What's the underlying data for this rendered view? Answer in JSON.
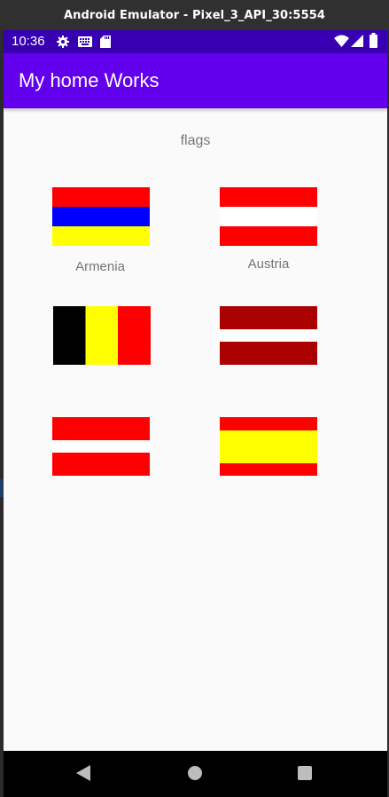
{
  "window": {
    "title": "Android Emulator - Pixel_3_API_30:5554"
  },
  "status_bar": {
    "time": "10:36",
    "icons": [
      "gear-icon",
      "keyboard-icon",
      "sd-card-icon",
      "wifi-icon",
      "signal-icon",
      "battery-icon"
    ]
  },
  "app_bar": {
    "title": "My home Works"
  },
  "main": {
    "heading": "flags",
    "flags": [
      {
        "label": "Armenia",
        "colors": [
          "#ff0000",
          "#0000ff",
          "#ffff00"
        ]
      },
      {
        "label": "Austria",
        "colors": [
          "#ff0000",
          "#ffffff",
          "#ff0000"
        ]
      },
      {
        "label": "",
        "colors": [
          "#000000",
          "#ffff00",
          "#ff0000"
        ]
      },
      {
        "label": "",
        "colors": [
          "#aa0000",
          "#ffffff",
          "#aa0000"
        ]
      },
      {
        "label": "",
        "colors": [
          "#ff0000",
          "#ffffff",
          "#ff0000"
        ]
      },
      {
        "label": "",
        "colors": [
          "#ff0000",
          "#ffff00",
          "#ff0000"
        ]
      }
    ]
  },
  "nav_bar": {
    "buttons": [
      "back-icon",
      "home-icon",
      "recents-icon"
    ]
  },
  "colors": {
    "primary": "#6200ee",
    "primary_dark": "#3700b3",
    "background": "#fafafa"
  }
}
